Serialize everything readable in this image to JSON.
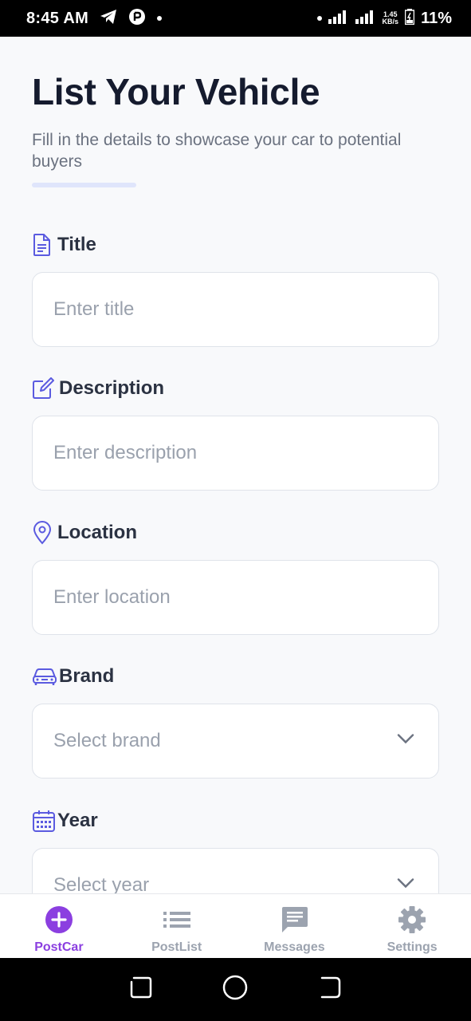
{
  "status_bar": {
    "time": "8:45 AM",
    "net_speed_value": "1.45",
    "net_speed_unit": "KB/s",
    "battery_percent": "11%"
  },
  "header": {
    "title": "List Your Vehicle",
    "subtitle": "Fill in the details to showcase your car to potential buyers"
  },
  "form": {
    "title": {
      "label": "Title",
      "placeholder": "Enter title",
      "icon": "document-icon"
    },
    "description": {
      "label": "Description",
      "placeholder": "Enter description",
      "icon": "edit-icon"
    },
    "location": {
      "label": "Location",
      "placeholder": "Enter location",
      "icon": "map-pin-icon"
    },
    "brand": {
      "label": "Brand",
      "placeholder": "Select brand",
      "icon": "car-icon"
    },
    "year": {
      "label": "Year",
      "placeholder": "Select year",
      "icon": "calendar-icon"
    }
  },
  "bottom_nav": {
    "items": [
      {
        "label": "PostCar",
        "icon": "plus-circle-icon",
        "active": true
      },
      {
        "label": "PostList",
        "icon": "list-icon",
        "active": false
      },
      {
        "label": "Messages",
        "icon": "message-icon",
        "active": false
      },
      {
        "label": "Settings",
        "icon": "gear-icon",
        "active": false
      }
    ]
  },
  "colors": {
    "accent": "#8b3fe0",
    "icon_indigo": "#5b5be0",
    "title_text": "#151b2e",
    "inactive_nav": "#9ca3af"
  }
}
